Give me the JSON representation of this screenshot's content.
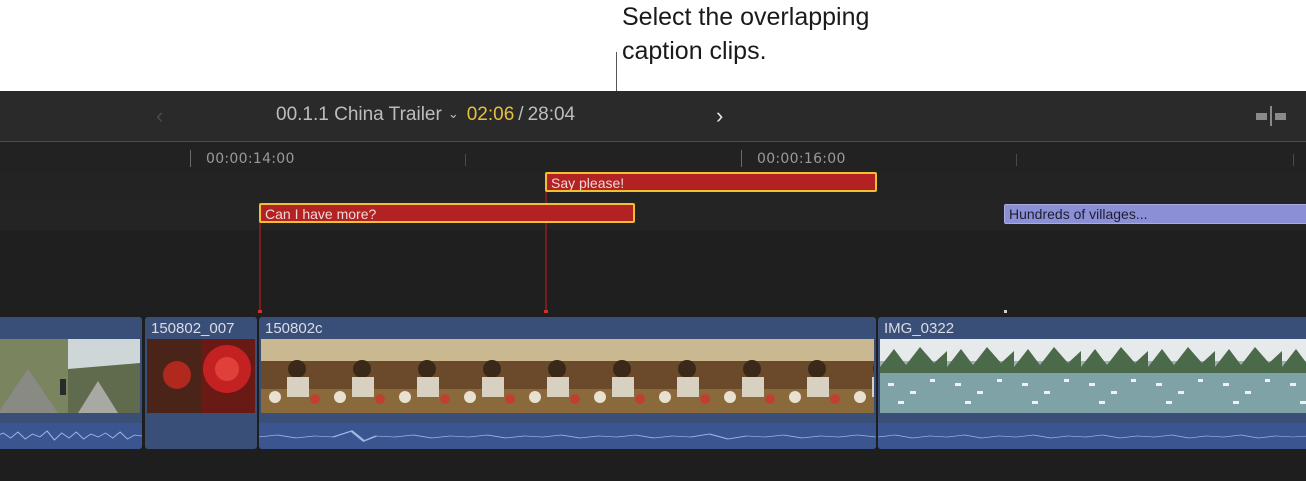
{
  "callout": {
    "line1": "Select the overlapping",
    "line2": "caption clips."
  },
  "toolbar": {
    "back_icon": "chevron-left-icon",
    "forward_icon": "chevron-right-icon",
    "project_name": "00.1.1 China Trailer",
    "current_time": "02:06",
    "separator": "/",
    "duration": "28:04",
    "snap_icon": "skimming-toggle-icon"
  },
  "ruler": {
    "labels": [
      "00:00:14:00",
      "00:00:16:00"
    ]
  },
  "captions": {
    "say_please": "Say please!",
    "can_i_have_more": "Can I have more?",
    "hundreds_of_villages": "Hundreds of villages..."
  },
  "clips": {
    "clip1": "",
    "clip2": "150802_007",
    "clip3": "150802c",
    "clip4": "IMG_0322"
  },
  "colors": {
    "selected_caption": "#b22222",
    "selection_border": "#f0c030",
    "caption_clip": "#8b8fd6",
    "video_clip": "#3a4f78",
    "timecode_accent": "#e8c03c"
  }
}
